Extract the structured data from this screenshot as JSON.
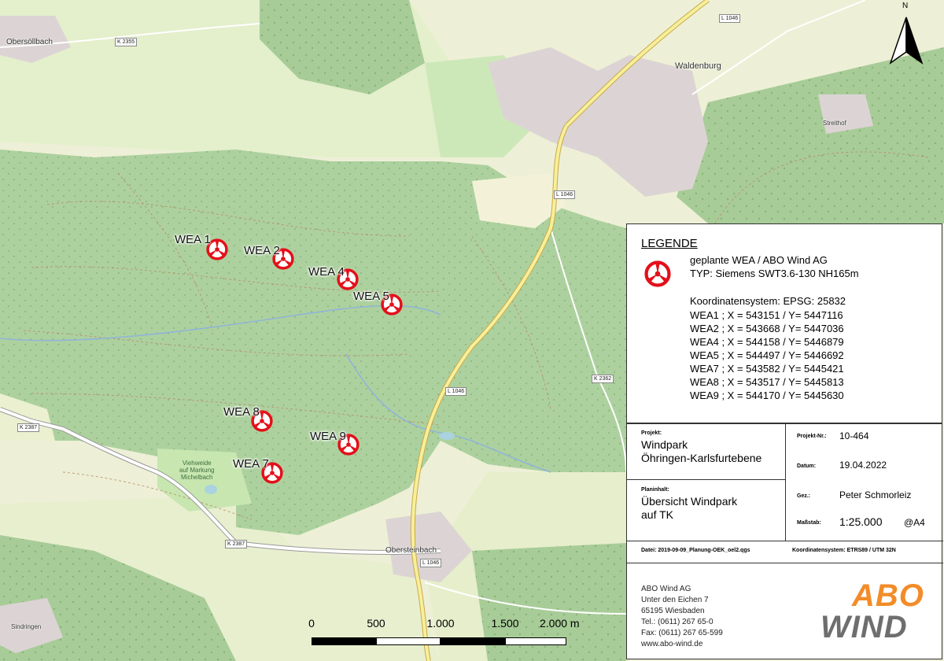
{
  "places": {
    "obersoellbach": "Obersöllbach",
    "waldenburg": "Waldenburg",
    "obersteinbach": "Obersteinbach",
    "streithof": "Streithof",
    "sindringen": "Sindringen"
  },
  "roads": {
    "k2355": "K 2355",
    "l1046_north": "L 1046",
    "l1046_mid": "L 1046",
    "l1046_south": "L 1046",
    "l1046_bottom": "L 1046",
    "k2387_west": "K 2387",
    "k2387_south": "K 2387",
    "k2362": "K 2362"
  },
  "map_labels": {
    "viehweide": "Viehweide\nauf Markung\nMichelbach"
  },
  "turbines": [
    {
      "label": "WEA 1"
    },
    {
      "label": "WEA 2"
    },
    {
      "label": "WEA 4"
    },
    {
      "label": "WEA 5"
    },
    {
      "label": "WEA 8"
    },
    {
      "label": "WEA 9"
    },
    {
      "label": "WEA 7"
    }
  ],
  "north_arrow": {
    "icon": "north-arrow-icon",
    "letter": "N"
  },
  "legend": {
    "title": "LEGENDE",
    "symbol_icon": "wind-turbine-icon",
    "symbol_color": "#e3101a",
    "type_line1": "geplante WEA / ABO Wind AG",
    "type_line2": "TYP: Siemens SWT3.6-130 NH165m",
    "crs": "Koordinatensystem: EPSG: 25832",
    "coordinates": [
      "WEA1 ; X = 543151 / Y= 5447116",
      "WEA2 ; X = 543668 / Y= 5447036",
      "WEA4 ; X = 544158 / Y= 5446879",
      "WEA5 ; X = 544497 / Y= 5446692",
      "WEA7 ; X = 543582 / Y= 5445421",
      "WEA8 ; X = 543517 / Y= 5445813",
      "WEA9 ; X = 544170 / Y= 5445630"
    ]
  },
  "titleblock": {
    "projekt_label": "Projekt:",
    "projekt_line1": "Windpark",
    "projekt_line2": "Öhringen-Karlsfurtebene",
    "planinhalt_label": "Planinhalt:",
    "planinhalt_line1": "Übersicht Windpark",
    "planinhalt_line2": "auf TK",
    "projektnr_label": "Projekt-Nr.:",
    "projektnr_value": "10-464",
    "datum_label": "Datum:",
    "datum_value": "19.04.2022",
    "gez_label": "Gez.:",
    "gez_value": "Peter Schmorleiz",
    "massstab_label": "Maßstab:",
    "massstab_value": "1:25.000",
    "paper_value": "@A4",
    "datei_label": "Datei: 2019-09-09_Planung-OEK_oel2.qgs",
    "koord_label": "Koordinatensystem: ETRS89 / UTM 32N",
    "company_name": "ABO Wind AG",
    "street": "Unter den Eichen 7",
    "city": "65195 Wiesbaden",
    "tel": "Tel.: (0611) 267 65-0",
    "fax": "Fax: (0611) 267 65-599",
    "web": "www.abo-wind.de",
    "logo_top": "ABO",
    "logo_bottom": "WIND",
    "logo_color_top": "#f28c28",
    "logo_color_bottom": "#6e6e6e"
  },
  "scalebar": {
    "labels": [
      "0",
      "500",
      "1.000",
      "1.500",
      "2.000 m"
    ]
  }
}
